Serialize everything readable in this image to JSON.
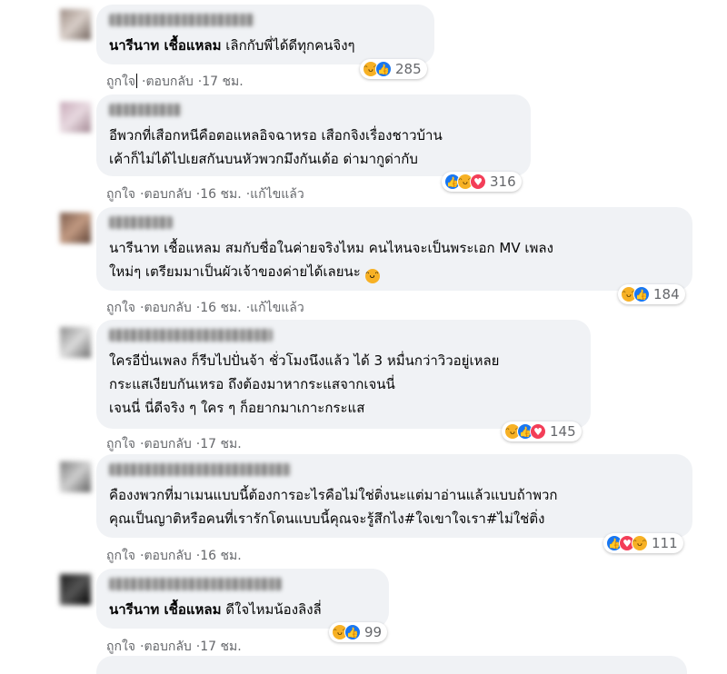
{
  "comments": [
    {
      "tag": "นารีนาท เชื้อแหลม",
      "text": " เลิกกับพี่ได้ดีทุกคนจิงๆ",
      "reaction_count": "285",
      "meta": {
        "like": "ถูกใจ",
        "reply": "ตอบกลับ",
        "time": "17 ชม.",
        "edited": ""
      }
    },
    {
      "tag": "",
      "text": "อีพวกที่เสือกหนีคือตอแหลอิจฉาหรอ เสือกจิงเรื่องชาวบ้าน\nเค้าก็ไม่ได้ไปเยสกันบนหัวพวกมึงกันเด้อ ด่ามากูด่ากับ",
      "reaction_count": "316",
      "meta": {
        "like": "ถูกใจ",
        "reply": "ตอบกลับ",
        "time": "16 ชม.",
        "edited": "แก้ไขแล้ว"
      }
    },
    {
      "tag": "",
      "text": "นารีนาท เชื้อแหลม สมกับชื่อในค่ายจริงไหม คนไหนจะเป็นพระเอก MV เพลง\nใหม่ๆ เตรียมมาเป็นผัวเจ้าของค่ายได้เลยนะ ",
      "reaction_count": "184",
      "meta": {
        "like": "ถูกใจ",
        "reply": "ตอบกลับ",
        "time": "16 ชม.",
        "edited": "แก้ไขแล้ว"
      }
    },
    {
      "tag": "",
      "text": "ใครอีปั่นเพลง ก็รีบไปปั่นจ้า ชั่วโมงนึงแล้ว ได้ 3 หมื่นกว่าวิวอยู่เหลย\nกระแสเงียบกันเหรอ ถึงต้องมาหากระแสจากเจนนี่\nเจนนี่ นี่ดีจริง ๆ ใคร ๆ ก็อยากมาเกาะกระแส",
      "reaction_count": "145",
      "meta": {
        "like": "ถูกใจ",
        "reply": "ตอบกลับ",
        "time": "17 ชม.",
        "edited": ""
      }
    },
    {
      "tag": "",
      "text": "คืองงพวกที่มาเมนแบบนี้ต้องการอะไรคือไม่ใช่ติ่งนะแต่มาอ่านแล้วแบบถ้าพวก\nคุณเป็นญาติหรือคนที่เรารักโดนแบบนี้คุณจะรู้สึกไง#ใจเขาใจเรา#ไม่ใช่ติ่ง",
      "reaction_count": "111",
      "meta": {
        "like": "ถูกใจ",
        "reply": "ตอบกลับ",
        "time": "16 ชม.",
        "edited": ""
      }
    },
    {
      "tag": "นารีนาท เชื้อแหลม",
      "text": " ดีใจไหมน้องลิงลี่",
      "reaction_count": "99",
      "meta": {
        "like": "ถูกใจ",
        "reply": "ตอบกลับ",
        "time": "17 ชม.",
        "edited": ""
      }
    }
  ],
  "colors": {
    "bubble": "#f0f2f5",
    "meta": "#65676b",
    "like": "#1877f2",
    "haha": "#f7b125",
    "love": "#f33e58"
  }
}
